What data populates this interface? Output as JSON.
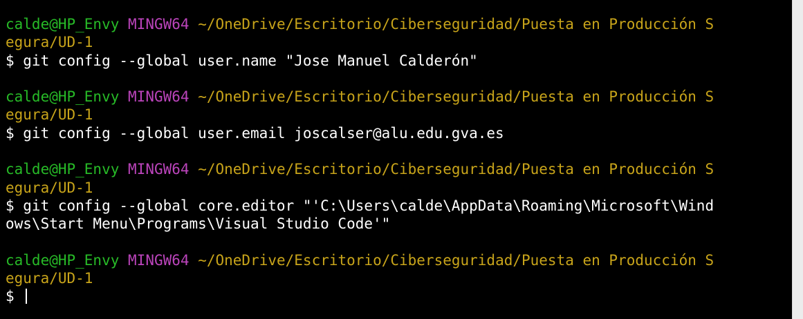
{
  "terminal": {
    "blocks": [
      {
        "user": "calde@HP_Envy",
        "host": "MINGW64",
        "path_line1": "~/OneDrive/Escritorio/Ciberseguridad/Puesta en Producción S",
        "path_line2": "egura/UD-1",
        "command_line1": "$ git config --global user.name \"Jose Manuel Calderón\"",
        "command_line2": ""
      },
      {
        "user": "calde@HP_Envy",
        "host": "MINGW64",
        "path_line1": "~/OneDrive/Escritorio/Ciberseguridad/Puesta en Producción S",
        "path_line2": "egura/UD-1",
        "command_line1": "$ git config --global user.email joscalser@alu.edu.gva.es",
        "command_line2": ""
      },
      {
        "user": "calde@HP_Envy",
        "host": "MINGW64",
        "path_line1": "~/OneDrive/Escritorio/Ciberseguridad/Puesta en Producción S",
        "path_line2": "egura/UD-1",
        "command_line1": "$ git config --global core.editor \"'C:\\Users\\calde\\AppData\\Roaming\\Microsoft\\Wind",
        "command_line2": "ows\\Start Menu\\Programs\\Visual Studio Code'\""
      },
      {
        "user": "calde@HP_Envy",
        "host": "MINGW64",
        "path_line1": "~/OneDrive/Escritorio/Ciberseguridad/Puesta en Producción S",
        "path_line2": "egura/UD-1",
        "command_line1": "$ ",
        "command_line2": ""
      }
    ],
    "colors": {
      "background": "#000000",
      "user": "#27ba27",
      "host": "#bb44bb",
      "path": "#c8a41a",
      "text": "#ffffff"
    }
  }
}
